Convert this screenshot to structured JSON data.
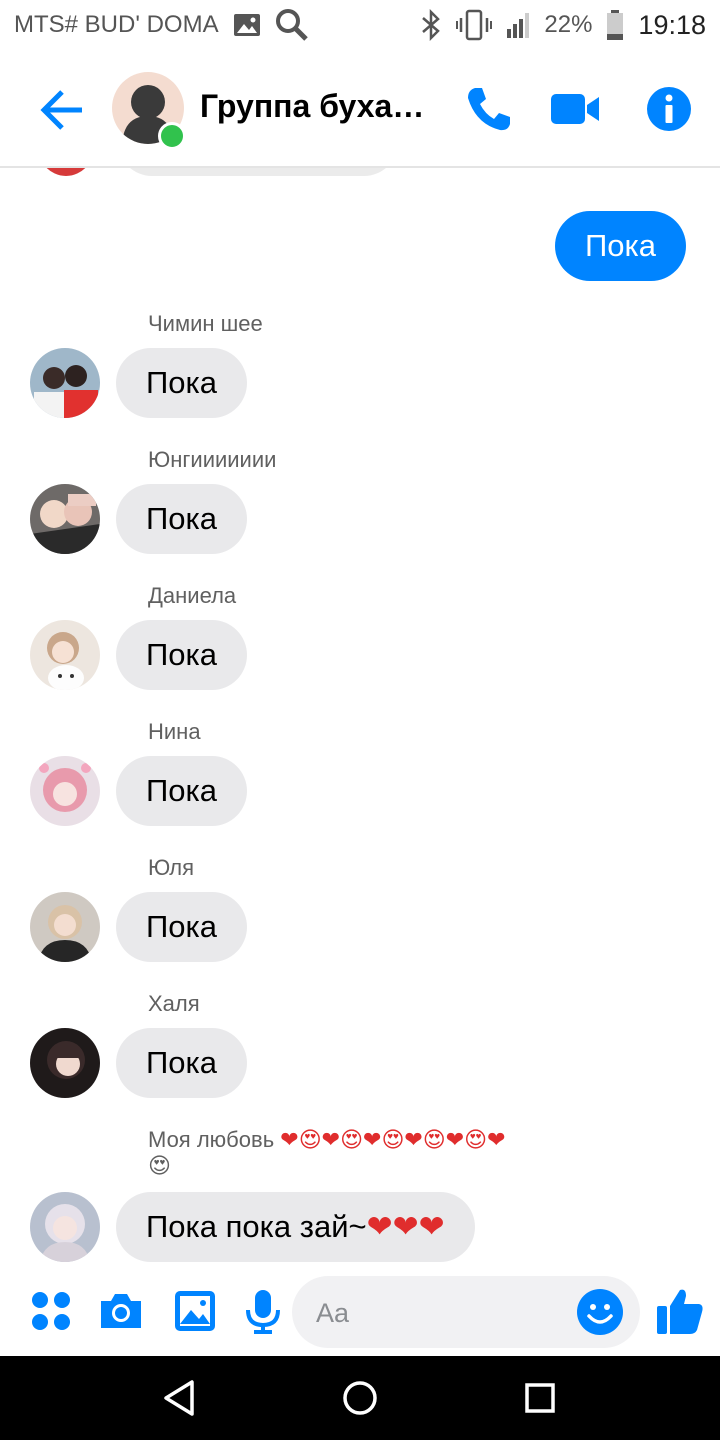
{
  "status_bar": {
    "carrier": "MTS# BUD' DOMA",
    "battery": "22%",
    "time": "19:18"
  },
  "header": {
    "title": "Группа бухающих",
    "online": true,
    "accent_color": "#0084ff"
  },
  "messages": {
    "outgoing": {
      "text": "Пока"
    },
    "incoming": [
      {
        "sender": "Чимин шее",
        "text": "Пока"
      },
      {
        "sender": "Юнгиииииии",
        "text": "Пока"
      },
      {
        "sender": "Даниела",
        "text": "Пока"
      },
      {
        "sender": "Нина",
        "text": "Пока"
      },
      {
        "sender": "Юля",
        "text": "Пока"
      },
      {
        "sender": "Халя",
        "text": "Пока"
      },
      {
        "sender": "Моя любовь",
        "text": "Пока пока зай~"
      }
    ]
  },
  "composer": {
    "placeholder": "Aa"
  },
  "icons": [
    "back-icon",
    "phone-icon",
    "video-icon",
    "info-icon",
    "apps-icon",
    "camera-icon",
    "gallery-icon",
    "mic-icon",
    "emoji-icon",
    "like-icon",
    "nav-back-icon",
    "nav-home-icon",
    "nav-recents-icon"
  ]
}
